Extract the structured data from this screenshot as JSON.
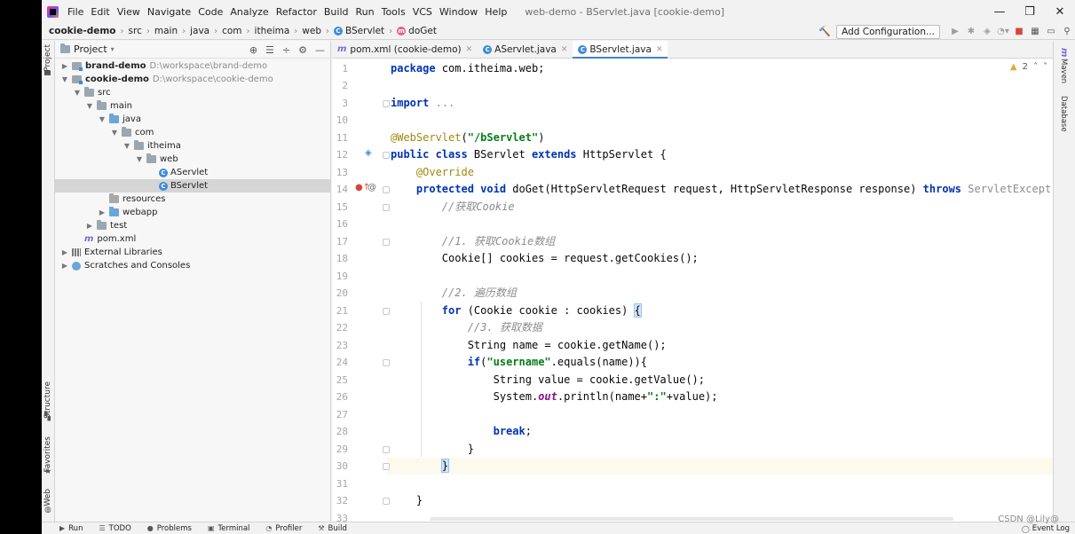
{
  "window": {
    "title": "web-demo - BServlet.java [cookie-demo]",
    "controls": [
      "—",
      "❐",
      "✕"
    ]
  },
  "menu": [
    "File",
    "Edit",
    "View",
    "Navigate",
    "Code",
    "Analyze",
    "Refactor",
    "Build",
    "Run",
    "Tools",
    "VCS",
    "Window",
    "Help"
  ],
  "breadcrumb": [
    "cookie-demo",
    "src",
    "main",
    "java",
    "com",
    "itheima",
    "web",
    "BServlet",
    "doGet"
  ],
  "toolbar": {
    "add_configuration": "Add Configuration..."
  },
  "left_stripe": {
    "project": "Project",
    "structure": "Structure",
    "favorites": "Favorites",
    "web": "Web"
  },
  "right_stripe": {
    "maven": "Maven",
    "database": "Database"
  },
  "project_panel": {
    "title": "Project",
    "tree": [
      {
        "label": "brand-demo",
        "path": "D:\\workspace\\brand-demo",
        "level": 0,
        "arrow": "▶",
        "kind": "module",
        "bold": true
      },
      {
        "label": "cookie-demo",
        "path": "D:\\workspace\\cookie-demo",
        "level": 0,
        "arrow": "▼",
        "kind": "module",
        "bold": true
      },
      {
        "label": "src",
        "path": "",
        "level": 1,
        "arrow": "▼",
        "kind": "folder"
      },
      {
        "label": "main",
        "path": "",
        "level": 2,
        "arrow": "▼",
        "kind": "folder"
      },
      {
        "label": "java",
        "path": "",
        "level": 3,
        "arrow": "▼",
        "kind": "folder-blue"
      },
      {
        "label": "com",
        "path": "",
        "level": 4,
        "arrow": "▼",
        "kind": "folder"
      },
      {
        "label": "itheima",
        "path": "",
        "level": 5,
        "arrow": "▼",
        "kind": "folder"
      },
      {
        "label": "web",
        "path": "",
        "level": 6,
        "arrow": "▼",
        "kind": "folder"
      },
      {
        "label": "AServlet",
        "path": "",
        "level": 7,
        "arrow": "",
        "kind": "class"
      },
      {
        "label": "BServlet",
        "path": "",
        "level": 7,
        "arrow": "",
        "kind": "class",
        "selected": true
      },
      {
        "label": "resources",
        "path": "",
        "level": 3,
        "arrow": "",
        "kind": "folder-res"
      },
      {
        "label": "webapp",
        "path": "",
        "level": 3,
        "arrow": "▶",
        "kind": "folder-blue"
      },
      {
        "label": "test",
        "path": "",
        "level": 2,
        "arrow": "▶",
        "kind": "folder"
      },
      {
        "label": "pom.xml",
        "path": "",
        "level": 1,
        "arrow": "",
        "kind": "maven"
      },
      {
        "label": "External Libraries",
        "path": "",
        "level": 0,
        "arrow": "▶",
        "kind": "lib"
      },
      {
        "label": "Scratches and Consoles",
        "path": "",
        "level": 0,
        "arrow": "▶",
        "kind": "scratch"
      }
    ]
  },
  "tabs": [
    {
      "label": "pom.xml (cookie-demo)",
      "icon": "m",
      "active": false
    },
    {
      "label": "AServlet.java",
      "icon": "C",
      "active": false
    },
    {
      "label": "BServlet.java",
      "icon": "C",
      "active": true
    }
  ],
  "inspection": {
    "warnings": "2"
  },
  "code": [
    {
      "n": "1",
      "html": "<span class='kw'>package</span> com.itheima.web;"
    },
    {
      "n": "2",
      "html": ""
    },
    {
      "n": "3",
      "html": "<span class='kw'>import</span> <span class='gray-code'>...</span>"
    },
    {
      "n": "10",
      "html": ""
    },
    {
      "n": "11",
      "html": "<span class='ann'>@WebServlet</span>(<span class='str'>\"/bServlet\"</span>)"
    },
    {
      "n": "12",
      "html": "<span class='kw'>public class</span> BServlet <span class='kw'>extends</span> HttpServlet {"
    },
    {
      "n": "13",
      "html": "    <span class='ann'>@Override</span>"
    },
    {
      "n": "14",
      "html": "    <span class='kw'>protected void</span> doGet(HttpServletRequest request, HttpServletResponse response) <span class='kw'>throws</span> <span class='gray-code'>ServletExcept</span>"
    },
    {
      "n": "15",
      "html": "        <span class='cmt'>//获取Cookie</span>"
    },
    {
      "n": "16",
      "html": ""
    },
    {
      "n": "17",
      "html": "        <span class='cmt'>//1. 获取Cookie数组</span>"
    },
    {
      "n": "18",
      "html": "        Cookie[] cookies = request.getCookies();"
    },
    {
      "n": "19",
      "html": ""
    },
    {
      "n": "20",
      "html": "        <span class='cmt'>//2. 遍历数组</span>"
    },
    {
      "n": "21",
      "html": "        <span class='kw'>for</span> (Cookie cookie : cookies) <span class='brace-hl'>{</span>"
    },
    {
      "n": "22",
      "html": "            <span class='cmt'>//3. 获取数据</span>"
    },
    {
      "n": "23",
      "html": "            String name = cookie.getName();"
    },
    {
      "n": "24",
      "html": "            <span class='kw'>if</span>(<span class='str'>\"username\"</span>.equals(name)){"
    },
    {
      "n": "25",
      "html": "                String value = cookie.getValue();"
    },
    {
      "n": "26",
      "html": "                System.<span class='static-it'>out</span>.println(name+<span class='str'>\":\"</span>+value);"
    },
    {
      "n": "27",
      "html": ""
    },
    {
      "n": "28",
      "html": "                <span class='kw'>break</span>;"
    },
    {
      "n": "29",
      "html": "            }"
    },
    {
      "n": "30",
      "html": "        <span class='brace-hl'>}</span>"
    },
    {
      "n": "31",
      "html": ""
    },
    {
      "n": "32",
      "html": "    }"
    },
    {
      "n": "33",
      "html": ""
    }
  ],
  "bottom_tools": [
    "Run",
    "TODO",
    "Problems",
    "Terminal",
    "Profiler",
    "Build"
  ],
  "event_log": "Event Log",
  "watermark": "CSDN @Lily@"
}
